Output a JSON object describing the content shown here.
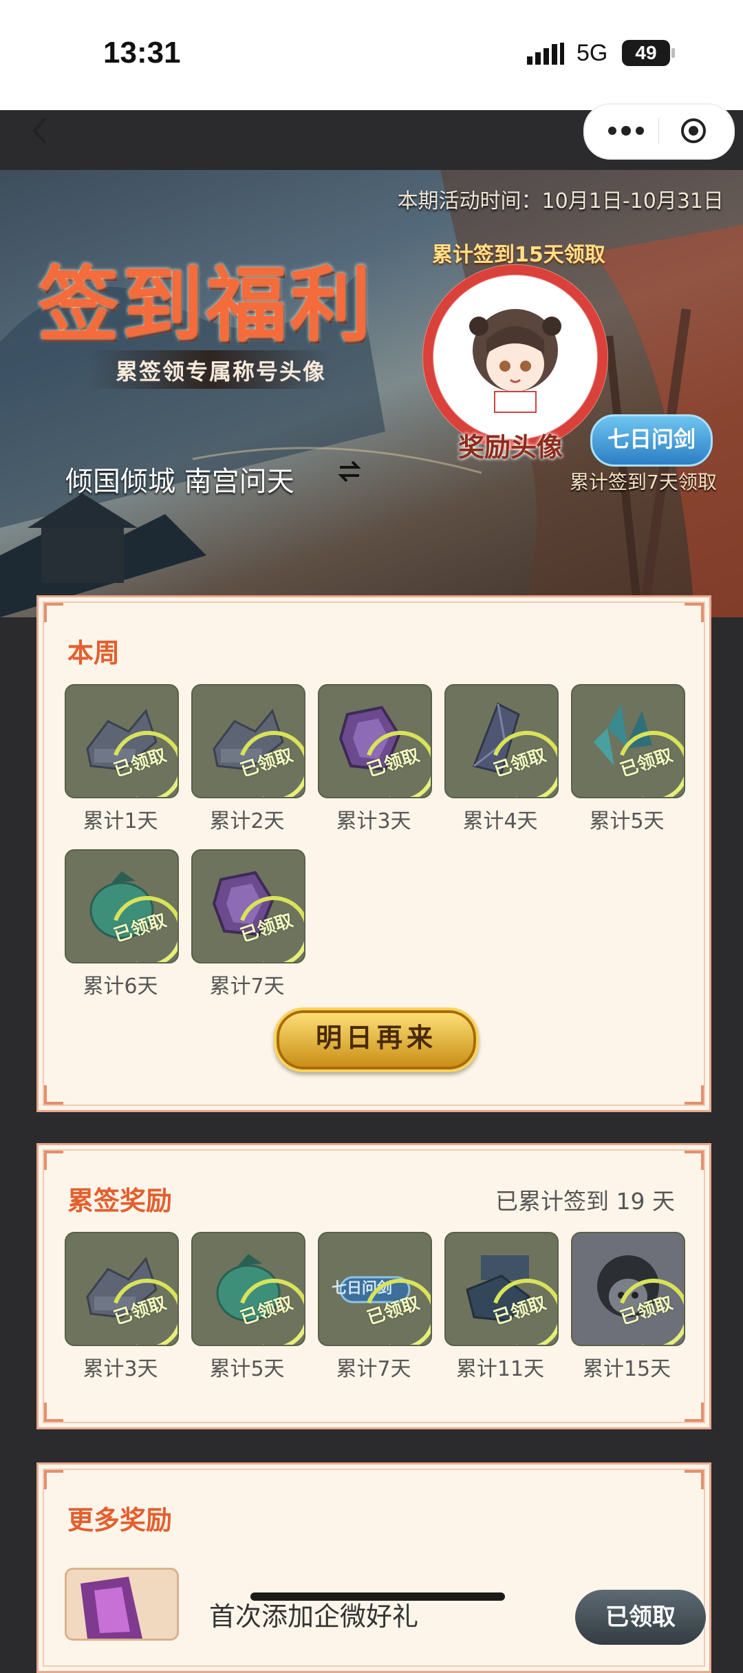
{
  "status": {
    "time": "13:31",
    "network": "5G",
    "battery": "49"
  },
  "nav": {
    "back": "back",
    "more": "more",
    "record": "record"
  },
  "banner": {
    "period": "本期活动时间：10月1日-10月31日",
    "title": "签到福利",
    "subtitle": "累签领专属称号头像",
    "current_title": "倾国倾城 南宫问天",
    "avatar_hint": "累计签到15天领取",
    "avatar_label": "奖励头像",
    "badge": "七日问剑",
    "badge_hint": "累计签到7天领取"
  },
  "week": {
    "title": "本周",
    "items": [
      {
        "label": "累计1天",
        "stamp": "已领取",
        "icon": "war-machine-icon"
      },
      {
        "label": "累计2天",
        "stamp": "已领取",
        "icon": "war-machine-icon"
      },
      {
        "label": "累计3天",
        "stamp": "已领取",
        "icon": "purple-gem-icon"
      },
      {
        "label": "累计4天",
        "stamp": "已领取",
        "icon": "crystal-icon"
      },
      {
        "label": "累计5天",
        "stamp": "已领取",
        "icon": "teal-crystal-icon"
      },
      {
        "label": "累计6天",
        "stamp": "已领取",
        "icon": "green-pouch-icon"
      },
      {
        "label": "累计7天",
        "stamp": "已领取",
        "icon": "purple-gem-icon"
      }
    ],
    "button": "明日再来"
  },
  "cumulative": {
    "title": "累签奖励",
    "summary": "已累计签到 19 天",
    "items": [
      {
        "label": "累计3天",
        "stamp": "已领取",
        "icon": "war-machine-icon"
      },
      {
        "label": "累计5天",
        "stamp": "已领取",
        "icon": "green-pouch-icon"
      },
      {
        "label": "累计7天",
        "stamp": "已领取",
        "icon": "title-plaque-icon",
        "badge": "七日问剑"
      },
      {
        "label": "累计11天",
        "stamp": "已领取",
        "icon": "cannon-icon"
      },
      {
        "label": "累计15天",
        "stamp": "已领取",
        "icon": "avatar-icon"
      }
    ]
  },
  "more": {
    "title": "更多奖励",
    "row_text": "首次添加企微好礼",
    "row_button": "已领取"
  },
  "colors": {
    "accent": "#e35f2f",
    "stamp": "#d9e35a",
    "tile": "#6e735d"
  }
}
